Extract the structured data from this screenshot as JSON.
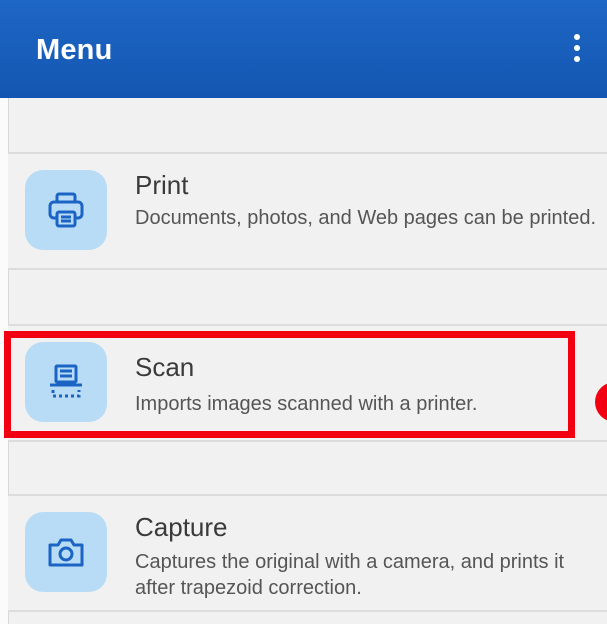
{
  "header": {
    "title": "Menu",
    "more_icon": "more-vert-icon"
  },
  "items": [
    {
      "icon": "printer-icon",
      "title": "Print",
      "description": "Documents, photos, and Web pages can be printed."
    },
    {
      "icon": "scanner-icon",
      "title": "Scan",
      "description": "Imports images scanned with a printer."
    },
    {
      "icon": "camera-icon",
      "title": "Capture",
      "description": "Captures the original with a camera, and prints it after trapezoid correction."
    }
  ],
  "colors": {
    "header": "#1b62c0",
    "icon_bg": "#b9dcf6",
    "icon_stroke": "#1c64c4",
    "highlight": "#f20012"
  }
}
